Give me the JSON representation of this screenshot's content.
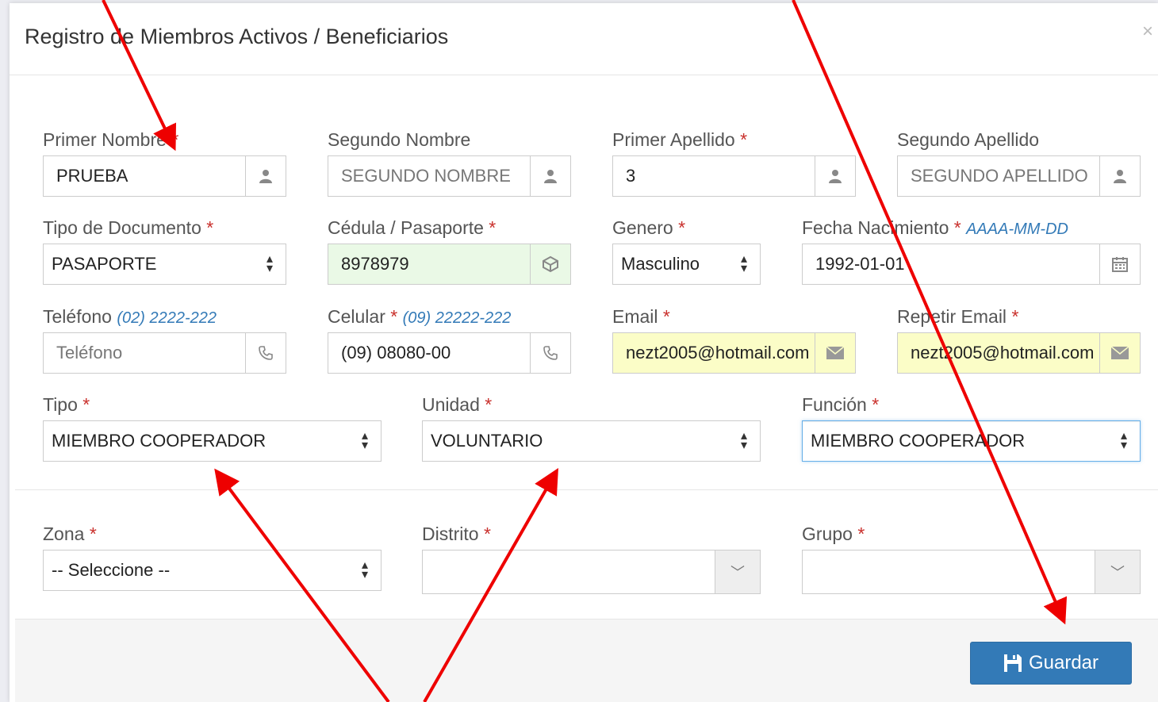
{
  "modal": {
    "title": "Registro de Miembros Activos / Beneficiarios",
    "close": "×"
  },
  "fields": {
    "primer_nombre": {
      "label": "Primer Nombre",
      "req": "*",
      "value": "PRUEBA"
    },
    "segundo_nombre": {
      "label": "Segundo Nombre",
      "placeholder": "SEGUNDO NOMBRE"
    },
    "primer_apellido": {
      "label": "Primer Apellido",
      "req": "*",
      "value": "3"
    },
    "segundo_apellido": {
      "label": "Segundo Apellido",
      "placeholder": "SEGUNDO APELLIDO"
    },
    "tipo_documento": {
      "label": "Tipo de Documento",
      "req": "*",
      "value": "PASAPORTE"
    },
    "cedula": {
      "label": "Cédula / Pasaporte",
      "req": "*",
      "value": "8978979"
    },
    "genero": {
      "label": "Genero",
      "req": "*",
      "value": "Masculino"
    },
    "fecha_nacimiento": {
      "label": "Fecha Nacimiento",
      "req": "*",
      "hint": "AAAA-MM-DD",
      "value": "1992-01-01"
    },
    "telefono": {
      "label": "Teléfono",
      "hint": "(02) 2222-222",
      "placeholder": "Teléfono"
    },
    "celular": {
      "label": "Celular",
      "req": "*",
      "hint": "(09) 22222-222",
      "value": "(09) 08080-00"
    },
    "email": {
      "label": "Email",
      "req": "*",
      "value": "nezt2005@hotmail.com"
    },
    "repetir_email": {
      "label": "Repetir Email",
      "req": "*",
      "value": "nezt2005@hotmail.com"
    },
    "tipo": {
      "label": "Tipo",
      "req": "*",
      "value": "MIEMBRO COOPERADOR"
    },
    "unidad": {
      "label": "Unidad",
      "req": "*",
      "value": "VOLUNTARIO"
    },
    "funcion": {
      "label": "Función",
      "req": "*",
      "value": "MIEMBRO COOPERADOR"
    },
    "zona": {
      "label": "Zona",
      "req": "*",
      "value": "-- Seleccione --"
    },
    "distrito": {
      "label": "Distrito",
      "req": "*",
      "value": ""
    },
    "grupo": {
      "label": "Grupo",
      "req": "*",
      "value": ""
    }
  },
  "footer": {
    "save_label": "Guardar"
  },
  "icons": {
    "user": "user-icon",
    "calendar": "calendar-icon",
    "phone": "phone-icon",
    "envelope": "envelope-icon",
    "id": "id-card-icon",
    "save": "floppy-disk-icon"
  },
  "colors": {
    "primary": "#337ab7",
    "valid_green": "#eaf9e6",
    "autofill_yellow": "#fbfdc7",
    "annotation_red": "#ee0000"
  }
}
